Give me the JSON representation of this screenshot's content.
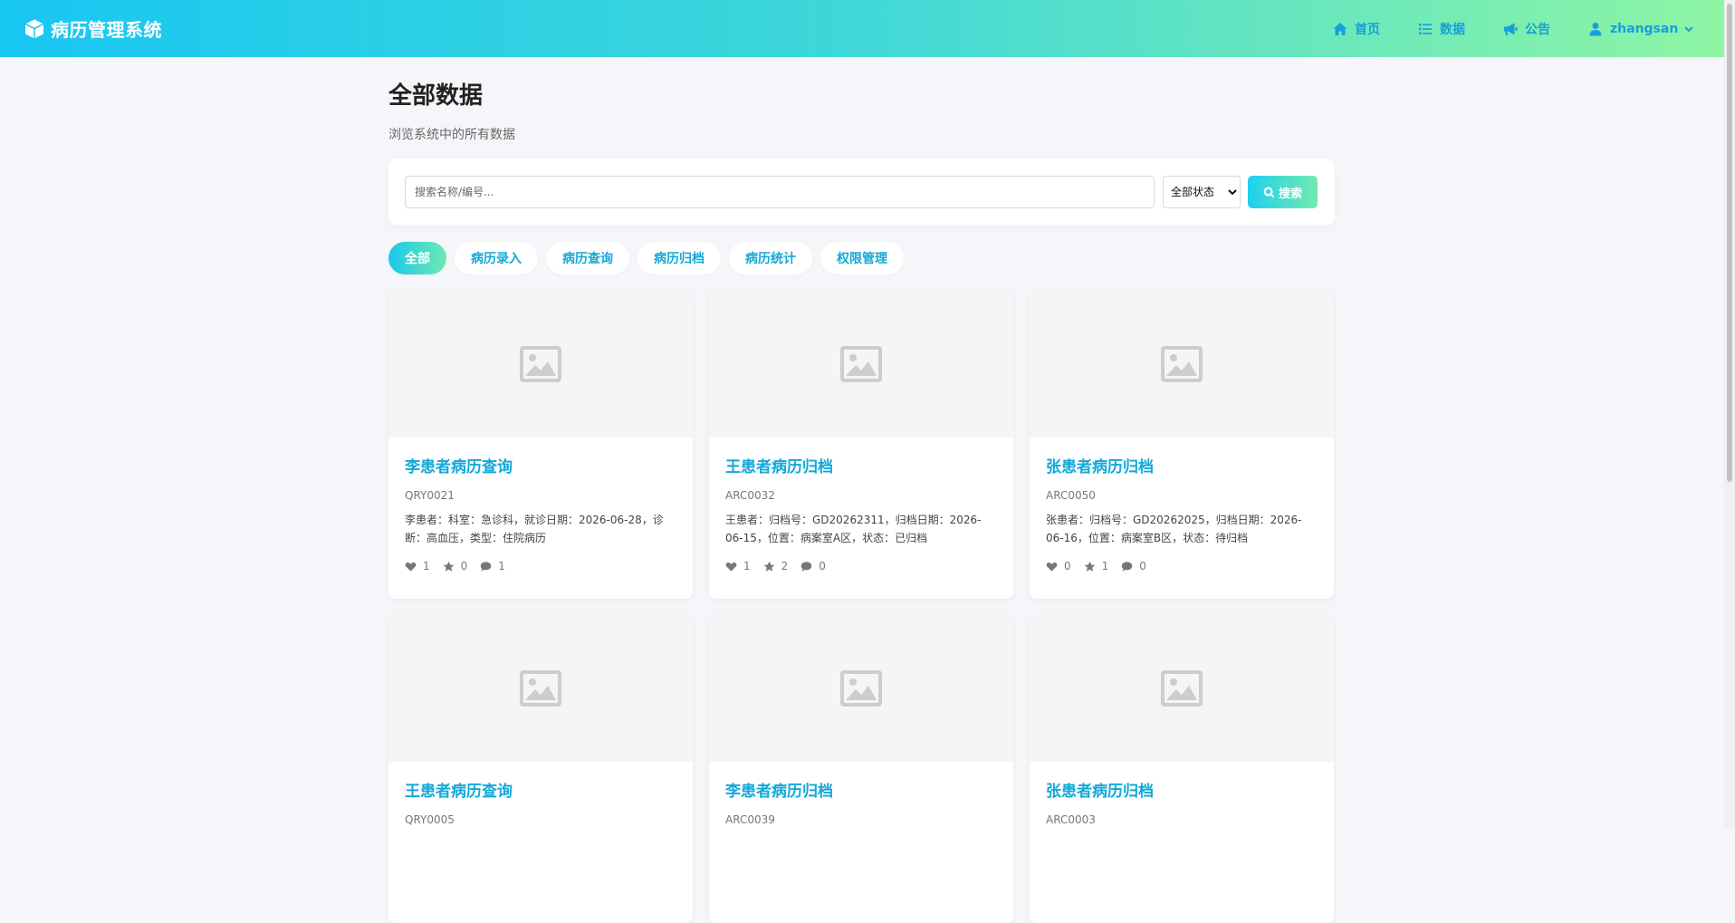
{
  "app": {
    "title": "病历管理系统"
  },
  "nav": {
    "home": "首页",
    "data": "数据",
    "notice": "公告",
    "user": "zhangsan"
  },
  "page": {
    "title": "全部数据",
    "subtitle": "浏览系统中的所有数据"
  },
  "search": {
    "placeholder": "搜索名称/编号...",
    "value": "",
    "status_selected": "全部状态",
    "button": "搜索"
  },
  "tabs": [
    {
      "label": "全部",
      "active": true
    },
    {
      "label": "病历录入",
      "active": false
    },
    {
      "label": "病历查询",
      "active": false
    },
    {
      "label": "病历归档",
      "active": false
    },
    {
      "label": "病历统计",
      "active": false
    },
    {
      "label": "权限管理",
      "active": false
    }
  ],
  "cards": [
    {
      "title": "李患者病历查询",
      "code": "QRY0021",
      "desc": "李患者：科室：急诊科，就诊日期：2026-06-28，诊断：高血压，类型：住院病历",
      "likes": "1",
      "stars": "0",
      "comments": "1"
    },
    {
      "title": "王患者病历归档",
      "code": "ARC0032",
      "desc": "王患者：归档号：GD20262311，归档日期：2026-06-15，位置：病案室A区，状态：已归档",
      "likes": "1",
      "stars": "2",
      "comments": "0"
    },
    {
      "title": "张患者病历归档",
      "code": "ARC0050",
      "desc": "张患者：归档号：GD20262025，归档日期：2026-06-16，位置：病案室B区，状态：待归档",
      "likes": "0",
      "stars": "1",
      "comments": "0"
    },
    {
      "title": "王患者病历查询",
      "code": "QRY0005",
      "desc": "",
      "likes": "",
      "stars": "",
      "comments": ""
    },
    {
      "title": "李患者病历归档",
      "code": "ARC0039",
      "desc": "",
      "likes": "",
      "stars": "",
      "comments": ""
    },
    {
      "title": "张患者病历归档",
      "code": "ARC0003",
      "desc": "",
      "likes": "",
      "stars": "",
      "comments": ""
    }
  ],
  "colors": {
    "accent": "#12a8d8",
    "header_start": "#18c6f2",
    "header_end": "#8ef5a4"
  }
}
